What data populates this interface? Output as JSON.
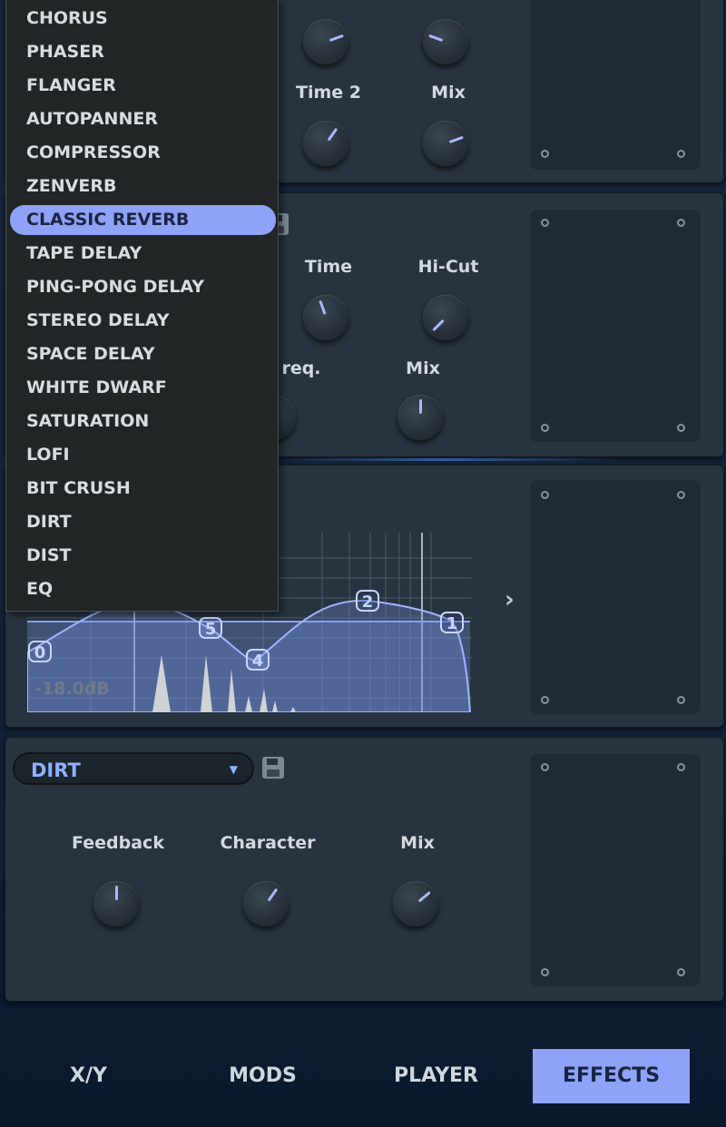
{
  "colors": {
    "accent": "#8ea3f7",
    "panel": "#27333f",
    "knob_indicator": "#a9b8ff",
    "menu_bg": "#222526"
  },
  "panel1": {
    "knob_labels": [
      "Time 2",
      "Mix"
    ]
  },
  "panel2": {
    "knob_labels_top": [
      "Time",
      "Hi-Cut"
    ],
    "knob_labels_bottom": [
      "req.",
      "Mix"
    ]
  },
  "eq": {
    "gain_label": "-18.0dB",
    "band_nodes": [
      "0",
      "5",
      "4",
      "2",
      "1"
    ],
    "next_icon": "chevron-right-icon"
  },
  "panel4": {
    "preset_value": "DIRT",
    "dropdown_arrow": "▼",
    "save_icon": "save-icon",
    "knob_labels": [
      "Feedback",
      "Character",
      "Mix"
    ]
  },
  "effect_menu": {
    "items": [
      "CHORUS",
      "PHASER",
      "FLANGER",
      "AUTOPANNER",
      "COMPRESSOR",
      "ZENVERB",
      "CLASSIC REVERB",
      "TAPE DELAY",
      "PING-PONG DELAY",
      "STEREO DELAY",
      "SPACE DELAY",
      "WHITE DWARF",
      "SATURATION",
      "LOFI",
      "BIT CRUSH",
      "DIRT",
      "DIST",
      "EQ"
    ],
    "selected": "CLASSIC REVERB"
  },
  "nav": {
    "tabs": [
      "X/Y",
      "MODS",
      "PLAYER",
      "EFFECTS"
    ],
    "active": "EFFECTS"
  }
}
